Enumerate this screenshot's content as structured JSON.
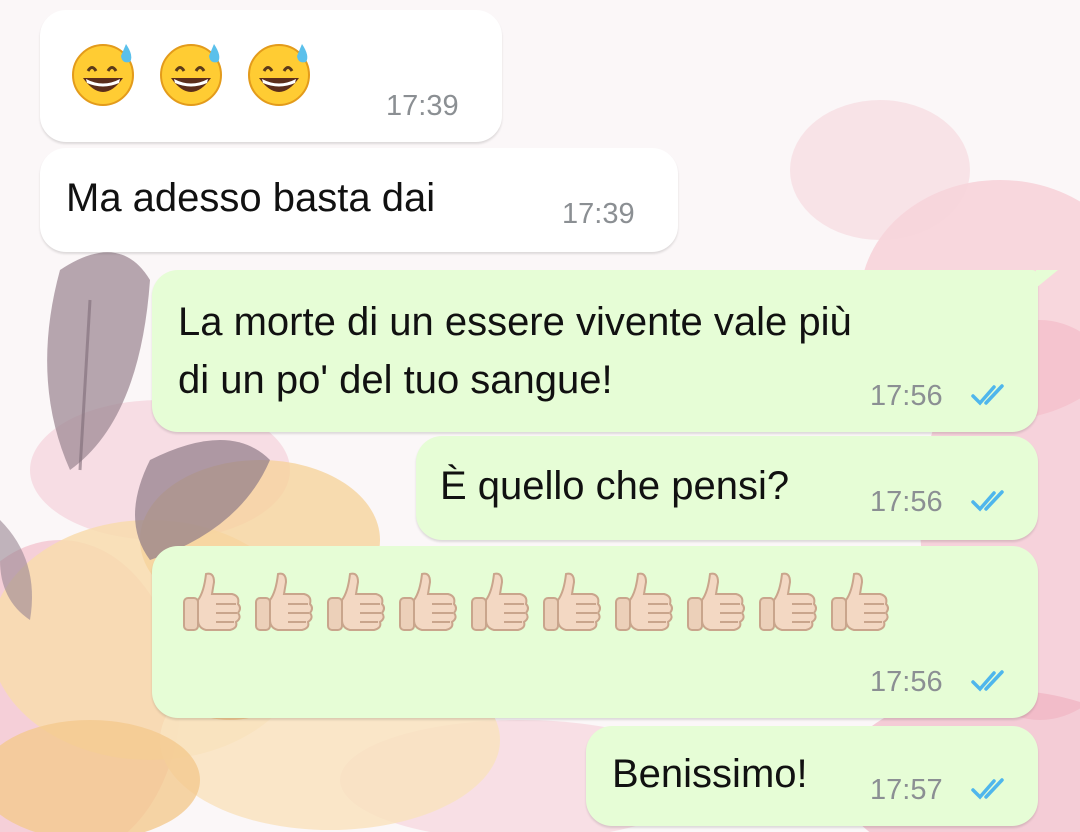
{
  "messages": [
    {
      "id": "m1",
      "direction": "incoming",
      "content": "emoji",
      "emoji_icon": "grinning-face-with-sweat-icon",
      "emoji_count": 3,
      "time": "17:39"
    },
    {
      "id": "m2",
      "direction": "incoming",
      "text": "Ma adesso basta dai",
      "time": "17:39"
    },
    {
      "id": "m3",
      "direction": "outgoing",
      "lines": [
        "La morte di un essere vivente vale più",
        "di un po' del tuo sangue!"
      ],
      "time": "17:56",
      "status": "read"
    },
    {
      "id": "m4",
      "direction": "outgoing",
      "text": "È quello che pensi?",
      "time": "17:56",
      "status": "read"
    },
    {
      "id": "m5",
      "direction": "outgoing",
      "content": "emoji",
      "emoji_icon": "thumbs-up-light-skin-icon",
      "emoji_count": 10,
      "time": "17:56",
      "status": "read"
    },
    {
      "id": "m6",
      "direction": "outgoing",
      "text": "Benissimo!",
      "time": "17:57",
      "status": "read"
    }
  ],
  "colors": {
    "incoming_bubble": "#ffffff",
    "outgoing_bubble": "#e6fdd6",
    "read_ticks": "#4fb6ec",
    "timestamp": "#8b8f93"
  }
}
